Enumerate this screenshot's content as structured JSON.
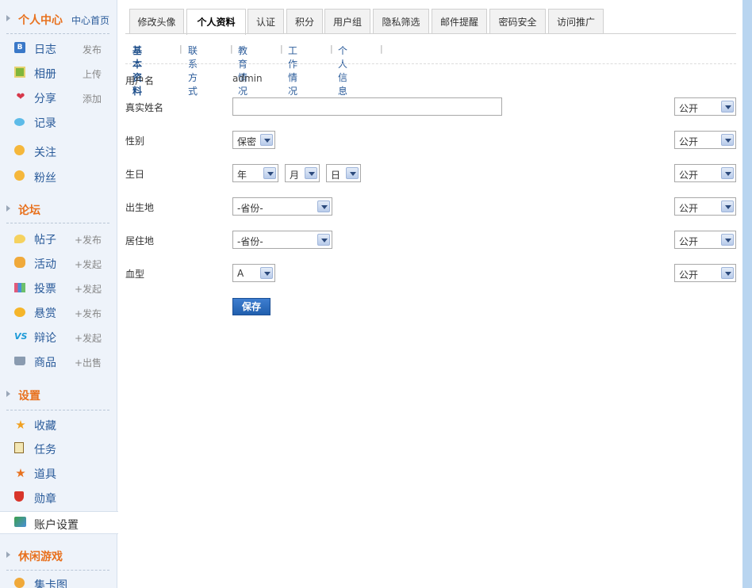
{
  "sidebar": {
    "personal": {
      "title": "个人中心",
      "home_link": "中心首页",
      "items": [
        {
          "label": "日志",
          "action": "发布",
          "icon": "blog-icon",
          "glyph": "B"
        },
        {
          "label": "相册",
          "action": "上传",
          "icon": "album-icon",
          "glyph": ""
        },
        {
          "label": "分享",
          "action": "添加",
          "icon": "share-icon",
          "glyph": "❤"
        },
        {
          "label": "记录",
          "action": "",
          "icon": "doing-icon",
          "glyph": ""
        },
        {
          "label": "关注",
          "action": "",
          "icon": "follow-icon",
          "glyph": ""
        },
        {
          "label": "粉丝",
          "action": "",
          "icon": "fans-icon",
          "glyph": ""
        }
      ]
    },
    "forum": {
      "title": "论坛",
      "items": [
        {
          "label": "帖子",
          "action": "+发布",
          "icon": "post-icon",
          "glyph": ""
        },
        {
          "label": "活动",
          "action": "+发起",
          "icon": "activity-icon",
          "glyph": ""
        },
        {
          "label": "投票",
          "action": "+发起",
          "icon": "poll-icon",
          "glyph": ""
        },
        {
          "label": "悬赏",
          "action": "+发布",
          "icon": "reward-icon",
          "glyph": ""
        },
        {
          "label": "辩论",
          "action": "+发起",
          "icon": "debate-icon",
          "glyph": "VS"
        },
        {
          "label": "商品",
          "action": "+出售",
          "icon": "goods-icon",
          "glyph": ""
        }
      ]
    },
    "settings": {
      "title": "设置",
      "items": [
        {
          "label": "收藏",
          "icon": "favorite-icon",
          "glyph": "★"
        },
        {
          "label": "任务",
          "icon": "task-icon",
          "glyph": ""
        },
        {
          "label": "道具",
          "icon": "prop-icon",
          "glyph": "★"
        },
        {
          "label": "勋章",
          "icon": "medal-icon",
          "glyph": ""
        }
      ],
      "current_item": {
        "label": "账户设置",
        "icon": "account-icon"
      }
    },
    "games": {
      "title": "休闲游戏",
      "items": [
        {
          "label": "集卡图",
          "icon": "jigsaw-icon"
        }
      ]
    }
  },
  "tabs": [
    {
      "label": "修改头像",
      "active": false
    },
    {
      "label": "个人资料",
      "active": true
    },
    {
      "label": "认证",
      "active": false
    },
    {
      "label": "积分",
      "active": false
    },
    {
      "label": "用户组",
      "active": false
    },
    {
      "label": "隐私筛选",
      "active": false
    },
    {
      "label": "邮件提醒",
      "active": false
    },
    {
      "label": "密码安全",
      "active": false
    },
    {
      "label": "访问推广",
      "active": false
    }
  ],
  "subnav": [
    {
      "label": "基本资料",
      "current": true
    },
    {
      "label": "联系方式",
      "current": false
    },
    {
      "label": "教育情况",
      "current": false
    },
    {
      "label": "工作情况",
      "current": false
    },
    {
      "label": "个人信息",
      "current": false
    }
  ],
  "form": {
    "username_label": "用户名",
    "username_value": "admin",
    "realname_label": "真实姓名",
    "realname_value": "",
    "gender_label": "性别",
    "gender_value": "保密",
    "birthday_label": "生日",
    "birthday_year": "年",
    "birthday_month": "月",
    "birthday_day": "日",
    "birthplace_label": "出生地",
    "birthplace_value": "-省份-",
    "residence_label": "居住地",
    "residence_value": "-省份-",
    "blood_label": "血型",
    "blood_value": "A",
    "privacy_value": "公开",
    "save_label": "保存"
  }
}
